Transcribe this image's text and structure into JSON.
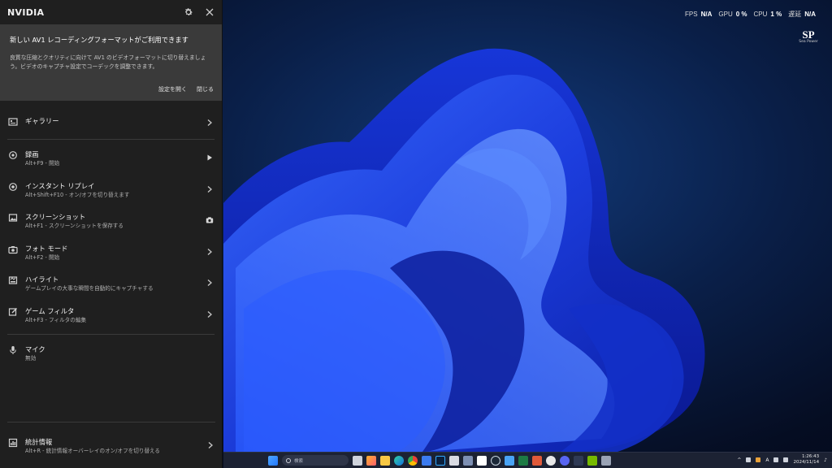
{
  "panel": {
    "title": "NVIDIA",
    "icons": {
      "settings": "gear-icon",
      "close": "close-icon"
    },
    "notice": {
      "title": "新しい AV1 レコーディングフォーマットがご利用できます",
      "body": "良質な圧縮とクオリティに向けて AV1 のビデオフォーマットに切り替えましょう。ビデオのキャプチャ設定でコーデックを調整できます。",
      "open_settings": "設定を開く",
      "close": "閉じる"
    },
    "menu": {
      "gallery": {
        "label": "ギャラリー"
      },
      "record": {
        "label": "録画",
        "sub": "Alt+F9 - 開始"
      },
      "instant_replay": {
        "label": "インスタント リプレイ",
        "sub": "Alt+Shift+F10 - オン/オフを切り替えます"
      },
      "screenshot": {
        "label": "スクリーンショット",
        "sub": "Alt+F1 - スクリーンショットを保存する"
      },
      "photo_mode": {
        "label": "フォト モード",
        "sub": "Alt+F2 - 開始"
      },
      "highlights": {
        "label": "ハイライト",
        "sub": "ゲームプレイの大事な瞬間を自動的にキャプチャする"
      },
      "game_filter": {
        "label": "ゲーム フィルタ",
        "sub": "Alt+F3 - フィルタの編集"
      },
      "mic": {
        "label": "マイク",
        "sub": "無効"
      },
      "stats": {
        "label": "統計情報",
        "sub": "Alt+R - 統計情報オーバーレイのオン/オフを切り替える"
      }
    }
  },
  "overlay": {
    "fps_label": "FPS",
    "fps_value": "N/A",
    "gpu_label": "GPU",
    "gpu_value": "0 %",
    "cpu_label": "CPU",
    "cpu_value": "1 %",
    "latency_label": "遅延",
    "latency_value": "N/A"
  },
  "desktop_logo": {
    "mark": "SP",
    "text": "Sea Power"
  },
  "taskbar": {
    "search_placeholder": "検索",
    "time": "1:26:43",
    "date": "2024/11/14",
    "tray_text": "A"
  },
  "colors": {
    "panel_bg": "#1f1f1f",
    "notice_bg": "#3a3a3a",
    "taskbar_bg": "#1c2233",
    "wallpaper_blue": "#1e4bff"
  }
}
